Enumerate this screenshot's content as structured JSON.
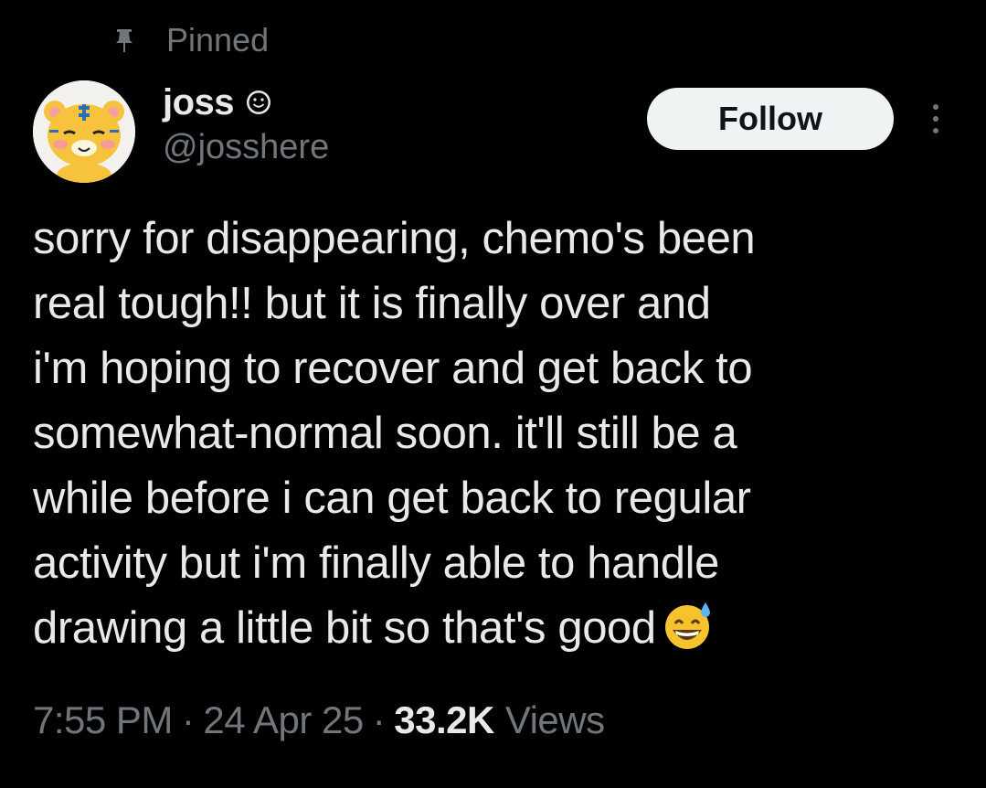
{
  "pinned": {
    "label": "Pinned",
    "icon": "pin-icon"
  },
  "author": {
    "display_name": "joss",
    "handle": "@josshere",
    "avatar_icon": "tiger-avatar",
    "name_badge_icon": "smile-icon"
  },
  "actions": {
    "follow_label": "Follow",
    "more_icon": "more-options-icon"
  },
  "tweet": {
    "text": "sorry for disappearing, chemo's been\nreal tough!! but it is finally over and\ni'm hoping to recover and get back to\nsomewhat-normal soon. it'll still be a\nwhile before i can get back to regular\nactivity but i'm finally able to handle\ndrawing a little bit so that's good",
    "emoji": "grinning-face-with-sweat-emoji"
  },
  "meta": {
    "time": "7:55 PM",
    "separator": "·",
    "date": "24 Apr 25",
    "views_count": "33.2K",
    "views_label": "Views"
  },
  "colors": {
    "background": "#000000",
    "text_primary": "#e7e9ea",
    "text_secondary": "#71767b",
    "follow_bg": "#eff3f4",
    "follow_text": "#0f1419"
  }
}
